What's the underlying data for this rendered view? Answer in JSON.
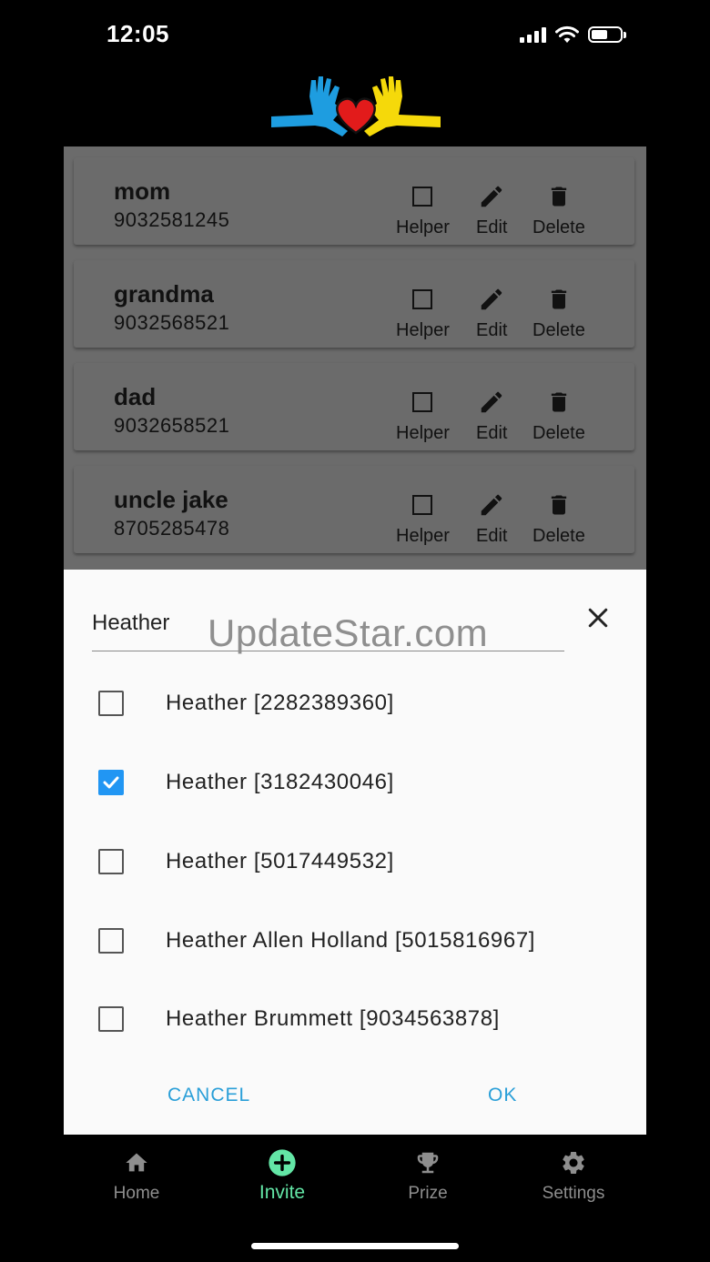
{
  "status_bar": {
    "time": "12:05",
    "battery_level": 0.55
  },
  "contacts": [
    {
      "name": "mom",
      "phone": "9032581245"
    },
    {
      "name": "grandma",
      "phone": "9032568521"
    },
    {
      "name": "dad",
      "phone": "9032658521"
    },
    {
      "name": "uncle jake",
      "phone": "8705285478"
    }
  ],
  "card_actions": {
    "helper": "Helper",
    "edit": "Edit",
    "delete": "Delete"
  },
  "dialog": {
    "search_value": "Heather",
    "watermark": "UpdateStar.com",
    "options": [
      {
        "label": "Heather [2282389360]",
        "checked": false
      },
      {
        "label": "Heather [3182430046]",
        "checked": true
      },
      {
        "label": "Heather [5017449532]",
        "checked": false
      },
      {
        "label": "Heather Allen Holland [5015816967]",
        "checked": false
      },
      {
        "label": "Heather Brummett [9034563878]",
        "checked": false
      }
    ],
    "cancel_label": "CANCEL",
    "ok_label": "OK"
  },
  "nav": {
    "home": "Home",
    "invite": "Invite",
    "prize": "Prize",
    "settings": "Settings",
    "active": "invite"
  },
  "colors": {
    "accent": "#2196f3",
    "button_text": "#2a9fd8",
    "nav_active": "#63e6a6",
    "logo_blue": "#1e9de0",
    "logo_yellow": "#f5d90a",
    "logo_red": "#e21b1b"
  }
}
